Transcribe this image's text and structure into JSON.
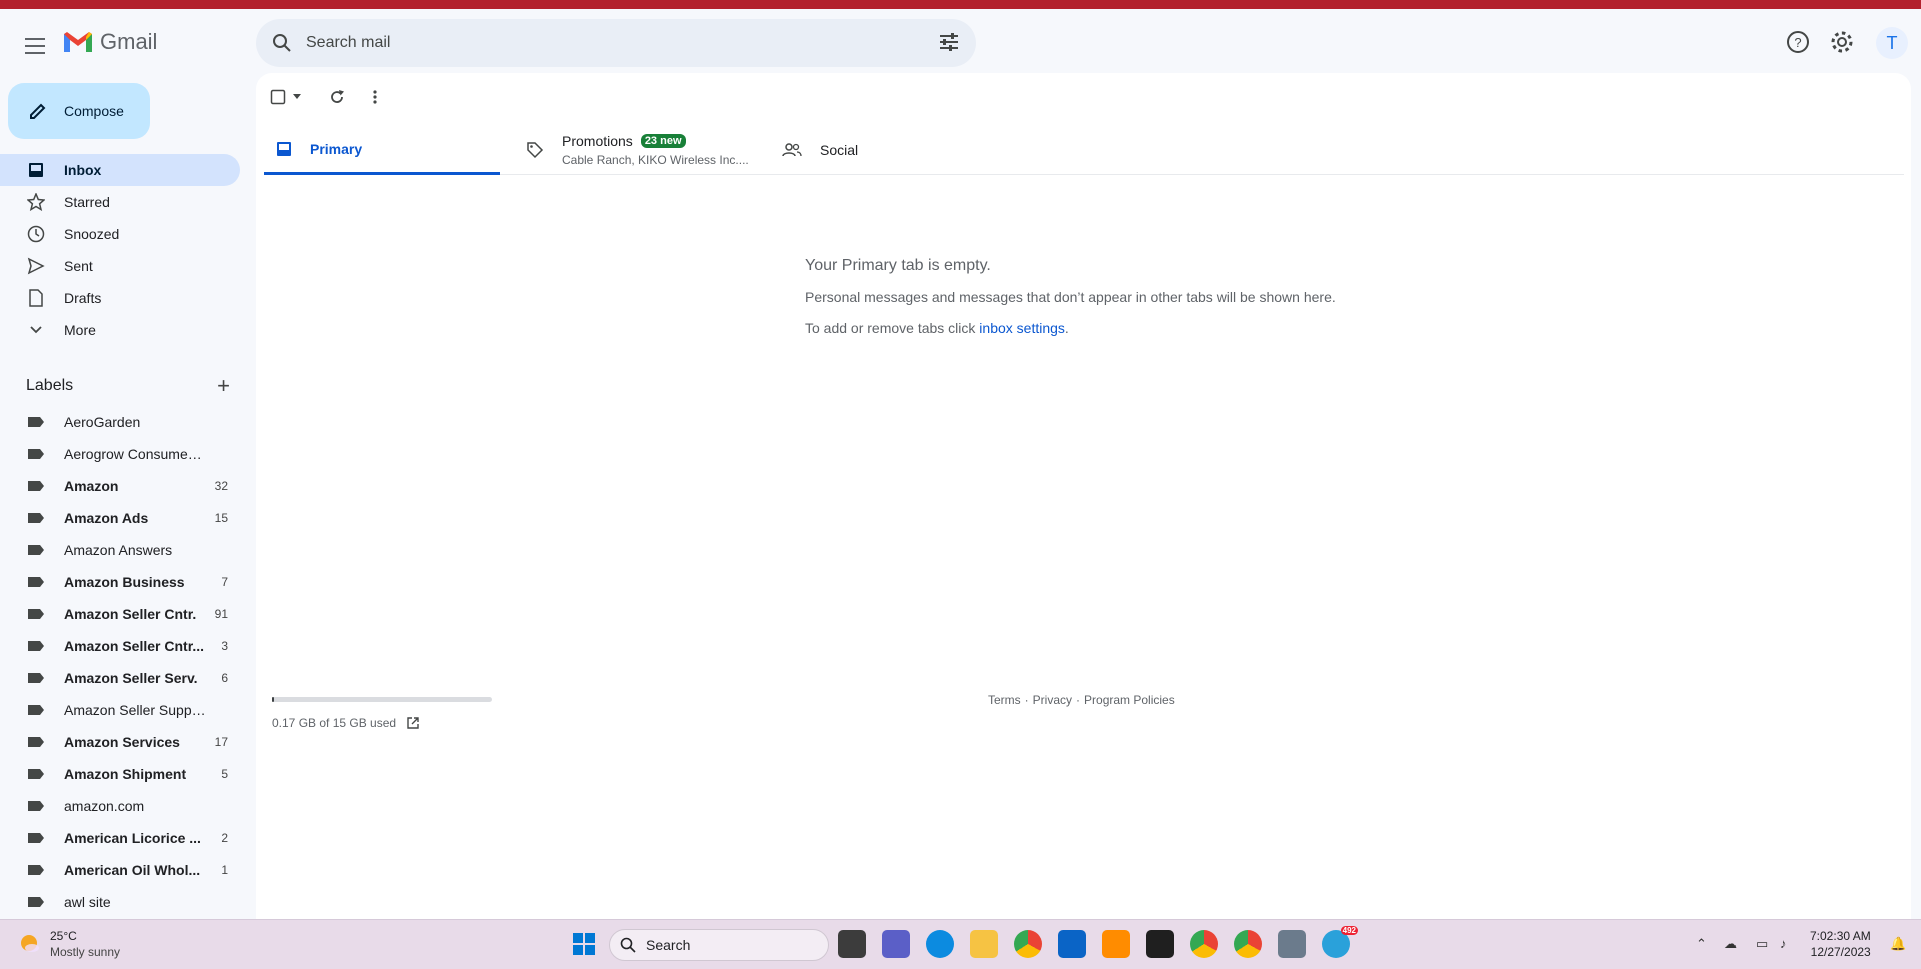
{
  "header": {
    "app_name": "Gmail",
    "search_placeholder": "Search mail",
    "avatar_letter": "T"
  },
  "sidebar": {
    "compose_label": "Compose",
    "nav_items": [
      {
        "label": "Inbox",
        "icon": "inbox-icon",
        "active": true
      },
      {
        "label": "Starred",
        "icon": "star-icon"
      },
      {
        "label": "Snoozed",
        "icon": "clock-icon"
      },
      {
        "label": "Sent",
        "icon": "send-icon"
      },
      {
        "label": "Drafts",
        "icon": "draft-icon"
      },
      {
        "label": "More",
        "icon": "chevron-down-icon"
      }
    ],
    "labels_title": "Labels",
    "labels": [
      {
        "name": "AeroGarden",
        "count": "",
        "bold": false
      },
      {
        "name": "Aerogrow Consumer Se...",
        "count": "",
        "bold": false
      },
      {
        "name": "Amazon",
        "count": "32",
        "bold": true
      },
      {
        "name": "Amazon Ads",
        "count": "15",
        "bold": true
      },
      {
        "name": "Amazon Answers",
        "count": "",
        "bold": false
      },
      {
        "name": "Amazon Business",
        "count": "7",
        "bold": true
      },
      {
        "name": "Amazon Seller Cntr.",
        "count": "91",
        "bold": true
      },
      {
        "name": "Amazon Seller Cntr...",
        "count": "3",
        "bold": true
      },
      {
        "name": "Amazon Seller Serv.",
        "count": "6",
        "bold": true
      },
      {
        "name": "Amazon Seller Support",
        "count": "",
        "bold": false
      },
      {
        "name": "Amazon Services",
        "count": "17",
        "bold": true
      },
      {
        "name": "Amazon Shipment",
        "count": "5",
        "bold": true
      },
      {
        "name": "amazon.com",
        "count": "",
        "bold": false
      },
      {
        "name": "American Licorice ...",
        "count": "2",
        "bold": true
      },
      {
        "name": "American Oil Whol...",
        "count": "1",
        "bold": true
      },
      {
        "name": "awl site",
        "count": "",
        "bold": false
      }
    ]
  },
  "tabs": {
    "primary": "Primary",
    "promotions": "Promotions",
    "promotions_badge": "23 new",
    "promotions_sub": "Cable Ranch, KIKO Wireless Inc....",
    "social": "Social"
  },
  "empty_state": {
    "title": "Your Primary tab is empty.",
    "line1": "Personal messages and messages that don’t appear in other tabs will be shown here.",
    "line2_prefix": "To add or remove tabs click ",
    "line2_link": "inbox settings",
    "line2_suffix": "."
  },
  "storage": {
    "text": "0.17 GB of 15 GB used",
    "used_fraction": 0.011
  },
  "footer": {
    "terms": "Terms",
    "sep1": "·",
    "privacy": "Privacy",
    "sep2": "·",
    "policies": "Program Policies"
  },
  "taskbar": {
    "weather_temp": "25°C",
    "weather_desc": "Mostly sunny",
    "search_label": "Search",
    "telegram_badge": "492",
    "time": "7:02:30 AM",
    "date": "12/27/2023"
  },
  "colors": {
    "accent": "#0b57d0",
    "compose_bg": "#c2e7ff",
    "active_nav": "#d3e3fd",
    "badge_green": "#188038"
  }
}
